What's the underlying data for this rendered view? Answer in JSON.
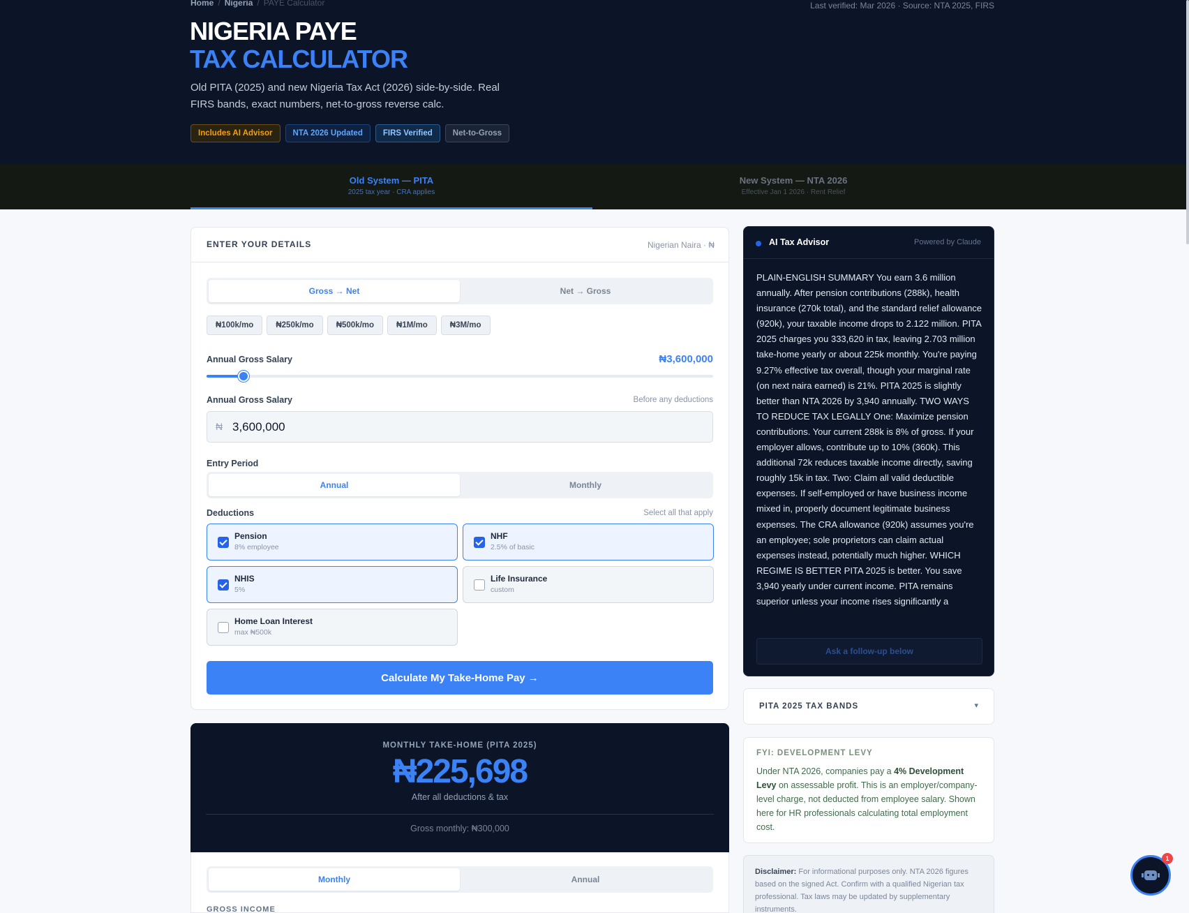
{
  "breadcrumb": {
    "home": "Home",
    "country": "Nigeria",
    "current": "PAYE Calculator"
  },
  "last_verified": "Last verified: Mar 2026 · Source: NTA 2025, FIRS",
  "hero": {
    "title_line1": "NIGERIA PAYE",
    "title_line2": "TAX CALCULATOR",
    "lead": "Old PITA (2025) and new Nigeria Tax Act (2026) side-by-side. Real FIRS bands, exact numbers, net-to-gross reverse calc.",
    "badges": [
      "Includes AI Advisor",
      "NTA 2026 Updated",
      "FIRS Verified",
      "Net-to-Gross"
    ]
  },
  "system_tabs": [
    {
      "label": "Old System — PITA",
      "sub": "2025 tax year · CRA applies",
      "active": true
    },
    {
      "label": "New System — NTA 2026",
      "sub": "Effective Jan 1 2026 · Rent Relief",
      "active": false
    }
  ],
  "details": {
    "title": "ENTER YOUR DETAILS",
    "currency": "Nigerian Naira · ₦",
    "direction": [
      "Gross → Net",
      "Net → Gross"
    ],
    "presets": [
      "₦100k/mo",
      "₦250k/mo",
      "₦500k/mo",
      "₦1M/mo",
      "₦3M/mo"
    ],
    "slider_label": "Annual Gross Salary",
    "slider_value": "₦3,600,000",
    "slider_fraction": 0.073,
    "input_label": "Annual Gross Salary",
    "input_hint": "Before any deductions",
    "currency_symbol": "₦",
    "input_value": "3,600,000",
    "period_label": "Entry Period",
    "period": [
      "Annual",
      "Monthly"
    ],
    "deductions_label": "Deductions",
    "deductions_hint": "Select all that apply",
    "deductions": [
      {
        "name": "Pension",
        "sub": "8% employee",
        "checked": true
      },
      {
        "name": "NHF",
        "sub": "2.5% of basic",
        "checked": true
      },
      {
        "name": "NHIS",
        "sub": "5%",
        "checked": true
      },
      {
        "name": "Life Insurance",
        "sub": "custom",
        "checked": false
      },
      {
        "name": "Home Loan Interest",
        "sub": "max ₦500k",
        "checked": false
      }
    ],
    "cta": "Calculate My Take-Home Pay →"
  },
  "result": {
    "label": "MONTHLY TAKE-HOME (PITA 2025)",
    "amount": "₦225,698",
    "sub": "After all deductions & tax",
    "gross": "Gross monthly: ₦300,000",
    "view": [
      "Monthly",
      "Annual"
    ],
    "section": "GROSS INCOME"
  },
  "ai": {
    "title": "AI Tax Advisor",
    "powered": "Powered by Claude",
    "body": "PLAIN-ENGLISH SUMMARY You earn 3.6 million annually. After pension contributions (288k), health insurance (270k total), and the standard relief allowance (920k), your taxable income drops to 2.122 million. PITA 2025 charges you 333,620 in tax, leaving 2.703 million take-home yearly or about 225k monthly. You're paying 9.27% effective tax overall, though your marginal rate (on next naira earned) is 21%. PITA 2025 is slightly better than NTA 2026 by 3,940 annually. TWO WAYS TO REDUCE TAX LEGALLY One: Maximize pension contributions. Your current 288k is 8% of gross. If your employer allows, contribute up to 10% (360k). This additional 72k reduces taxable income directly, saving roughly 15k in tax. Two: Claim all valid deductible expenses. If self-employed or have business income mixed in, properly document legitimate business expenses. The CRA allowance (920k) assumes you're an employee; sole proprietors can claim actual expenses instead, potentially much higher. WHICH REGIME IS BETTER PITA 2025 is better. You save 3,940 yearly under current income. PITA remains superior unless your income rises significantly a",
    "followup": "Ask a follow-up below"
  },
  "bands": {
    "title": "PITA 2025 TAX BANDS",
    "chevron": "▾"
  },
  "fyi": {
    "title": "FYI: DEVELOPMENT LEVY",
    "pre": "Under NTA 2026, companies pay a ",
    "bold": "4% Development Levy",
    "post": " on assessable profit. This is an employer/company-level charge, not deducted from employee salary. Shown here for HR professionals calculating total employment cost."
  },
  "disclaimer": {
    "label": "Disclaimer:",
    "text": " For informational purposes only. NTA 2026 figures based on the signed Act. Confirm with a qualified Nigerian tax professional. Tax laws may be updated by supplementary instruments."
  },
  "bot": {
    "count": "1"
  }
}
